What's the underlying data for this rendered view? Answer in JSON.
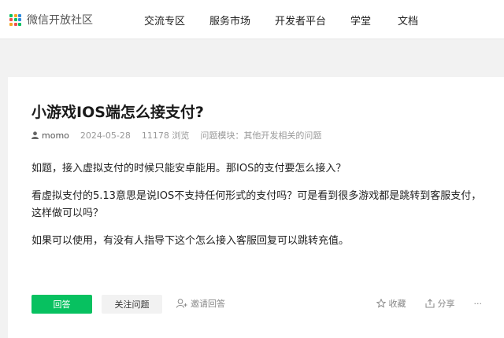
{
  "header": {
    "logo_text": "微信开放社区",
    "logo_colors": [
      "#07c160",
      "#f5a623",
      "#2e8bde",
      "#f0504f",
      "#07c160",
      "#2e8bde",
      "#f5a623",
      "#f0504f",
      "#07c160"
    ],
    "nav": [
      "交流专区",
      "服务市场",
      "开发者平台",
      "学堂",
      "文档"
    ]
  },
  "question": {
    "title": "小游戏IOS端怎么接支付?",
    "author": "momo",
    "date": "2024-05-28",
    "views": "11178 浏览",
    "module": "问题模块：其他开发相关的问题",
    "paragraphs": [
      "如题，接入虚拟支付的时候只能安卓能用。那IOS的支付要怎么接入？",
      "看虚拟支付的5.13意思是说IOS不支持任何形式的支付吗？可是看到很多游戏都是跳转到客服支付，这样做可以吗？",
      "如果可以使用，有没有人指导下这个怎么接入客服回复可以跳转充值。"
    ]
  },
  "actions": {
    "answer": "回答",
    "follow": "关注问题",
    "invite": "邀请回答",
    "collect": "收藏",
    "share": "分享",
    "more": "···"
  },
  "colors": {
    "accent": "#07c160"
  }
}
